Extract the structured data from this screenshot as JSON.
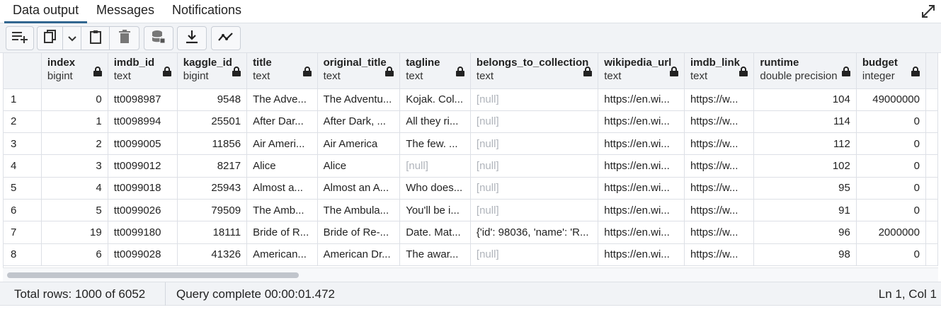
{
  "tabs": [
    {
      "label": "Data output",
      "active": true
    },
    {
      "label": "Messages",
      "active": false
    },
    {
      "label": "Notifications",
      "active": false
    }
  ],
  "toolbar": {
    "icons": [
      "add-row-icon",
      "copy-icon",
      "chevron-down-icon",
      "paste-icon",
      "delete-icon",
      "save-data-icon",
      "download-icon",
      "graph-icon"
    ]
  },
  "colors": {
    "accent": "#326690",
    "null_text": "#b0b4bb",
    "header_bg": "#f1f3f6"
  },
  "grid": {
    "columns": [
      {
        "name": "index",
        "type": "bigint"
      },
      {
        "name": "imdb_id",
        "type": "text"
      },
      {
        "name": "kaggle_id",
        "type": "bigint"
      },
      {
        "name": "title",
        "type": "text"
      },
      {
        "name": "original_title",
        "type": "text"
      },
      {
        "name": "tagline",
        "type": "text"
      },
      {
        "name": "belongs_to_collection",
        "type": "text"
      },
      {
        "name": "wikipedia_url",
        "type": "text"
      },
      {
        "name": "imdb_link",
        "type": "text"
      },
      {
        "name": "runtime",
        "type": "double precision"
      },
      {
        "name": "budget",
        "type": "integer"
      }
    ],
    "rows": [
      {
        "n": "1",
        "cells": [
          "0",
          "tt0098987",
          "9548",
          "The Adve...",
          "The Adventu...",
          "Kojak. Col...",
          "[null]",
          "https://en.wi...",
          "https://w...",
          "104",
          "49000000"
        ]
      },
      {
        "n": "2",
        "cells": [
          "1",
          "tt0098994",
          "25501",
          "After Dar...",
          "After Dark, ...",
          "All they ri...",
          "[null]",
          "https://en.wi...",
          "https://w...",
          "114",
          "0"
        ]
      },
      {
        "n": "3",
        "cells": [
          "2",
          "tt0099005",
          "11856",
          "Air Ameri...",
          "Air America",
          "The few. ...",
          "[null]",
          "https://en.wi...",
          "https://w...",
          "112",
          "0"
        ]
      },
      {
        "n": "4",
        "cells": [
          "3",
          "tt0099012",
          "8217",
          "Alice",
          "Alice",
          "[null]",
          "[null]",
          "https://en.wi...",
          "https://w...",
          "102",
          "0"
        ]
      },
      {
        "n": "5",
        "cells": [
          "4",
          "tt0099018",
          "25943",
          "Almost a...",
          "Almost an A...",
          "Who does...",
          "[null]",
          "https://en.wi...",
          "https://w...",
          "95",
          "0"
        ]
      },
      {
        "n": "6",
        "cells": [
          "5",
          "tt0099026",
          "79509",
          "The Amb...",
          "The Ambula...",
          "You'll be i...",
          "[null]",
          "https://en.wi...",
          "https://w...",
          "91",
          "0"
        ]
      },
      {
        "n": "7",
        "cells": [
          "19",
          "tt0099180",
          "18111",
          "Bride of R...",
          "Bride of Re-...",
          "Date. Mat...",
          "{'id': 98036, 'name': 'R...",
          "https://en.wi...",
          "https://w...",
          "96",
          "2000000"
        ]
      },
      {
        "n": "8",
        "cells": [
          "6",
          "tt0099028",
          "41326",
          "American...",
          "American Dr...",
          "The awar...",
          "[null]",
          "https://en.wi...",
          "https://w...",
          "98",
          "0"
        ]
      }
    ]
  },
  "status": {
    "total_rows": "Total rows: 1000 of 6052",
    "query": "Query complete 00:00:01.472",
    "cursor": "Ln 1, Col 1"
  }
}
